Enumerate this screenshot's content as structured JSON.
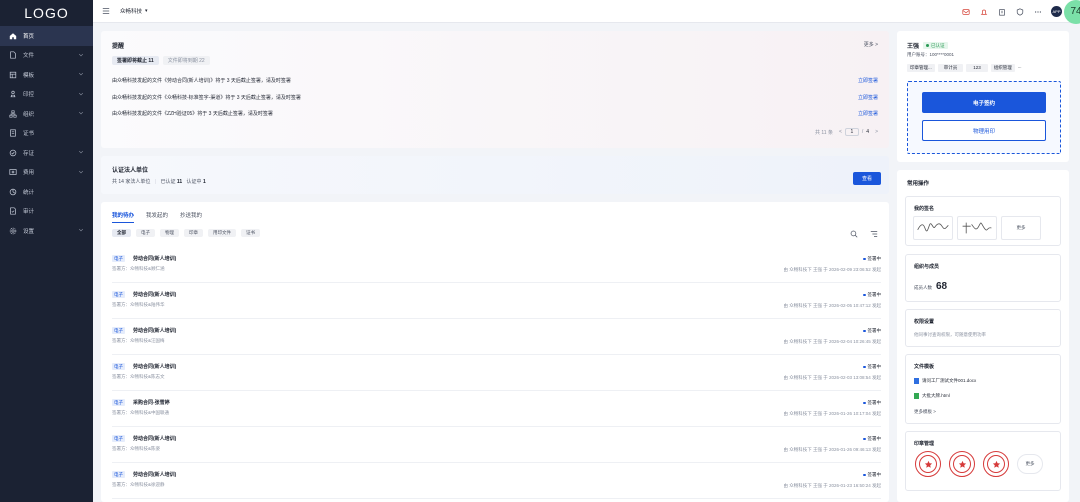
{
  "sidebar": {
    "logo": "LOGO",
    "items": [
      {
        "label": "首页",
        "icon": "home-icon",
        "active": true,
        "chevron": false
      },
      {
        "label": "文件",
        "icon": "file-icon",
        "active": false,
        "chevron": true
      },
      {
        "label": "模板",
        "icon": "template-icon",
        "active": false,
        "chevron": true
      },
      {
        "label": "印控",
        "icon": "seal-icon",
        "active": false,
        "chevron": true
      },
      {
        "label": "组织",
        "icon": "org-icon",
        "active": false,
        "chevron": true
      },
      {
        "label": "证书",
        "icon": "certificate-icon",
        "active": false,
        "chevron": false
      },
      {
        "label": "存证",
        "icon": "evidence-icon",
        "active": false,
        "chevron": true
      },
      {
        "label": "费用",
        "icon": "fee-icon",
        "active": false,
        "chevron": true
      },
      {
        "label": "统计",
        "icon": "stats-icon",
        "active": false,
        "chevron": false
      },
      {
        "label": "审计",
        "icon": "audit-icon",
        "active": false,
        "chevron": false
      },
      {
        "label": "设置",
        "icon": "settings-icon",
        "active": false,
        "chevron": true
      }
    ]
  },
  "topbar": {
    "org_name": "众畅科技",
    "avatar_text": "APP",
    "badge_count": "74"
  },
  "reminder": {
    "title": "提醒",
    "more": "更多 >",
    "chip_active": "签署即将截止 11",
    "chip_inactive": "文件即将到期 22",
    "rows": [
      {
        "text": "由众畅科技发起的文件《劳动合同(新人培训)》将于 3 天后截止签署，请及时签署",
        "action": "立即签署"
      },
      {
        "text": "由众畅科技发起的文件《众畅科技-标准签字-渠道》将于 3 天后截止签署，请及时签署",
        "action": "立即签署"
      },
      {
        "text": "由众畅科技发起的文件《ZZH验证05》将于 3 天后截止签署，请及时签署",
        "action": "立即签署"
      }
    ],
    "pager": {
      "total": "共 11 条",
      "prev": "<",
      "current": "1",
      "separator": "/",
      "pages": "4",
      "next": ">"
    }
  },
  "cert": {
    "title": "认证法人单位",
    "summary": "共 14 家法人单位",
    "certified_label": "已认证",
    "certified_value": "11",
    "pending_label": "认证中",
    "pending_value": "1",
    "button": "查看"
  },
  "todo": {
    "tabs": [
      "我的待办",
      "我发起的",
      "抄送我的"
    ],
    "filters": [
      "全部",
      "电子",
      "物理",
      "印章",
      "用印文件",
      "证书"
    ],
    "items": [
      {
        "tag": "电子",
        "title": "劳动合同(新人培训)",
        "party": "签署方：众畅科技&顾仁涵",
        "status": "签署中",
        "meta": "由 众畅科技下 王强 于 2026-02-09 23:06:52 发起"
      },
      {
        "tag": "电子",
        "title": "劳动合同(新人培训)",
        "party": "签署方：众畅科技&陆伟华",
        "status": "签署中",
        "meta": "由 众畅科技下 王强 于 2026-02-05 10:47:12 发起"
      },
      {
        "tag": "电子",
        "title": "劳动合同(新人培训)",
        "party": "签署方：众畅科技&汪国梅",
        "status": "签署中",
        "meta": "由 众畅科技下 王强 于 2026-02-04 10:26:45 发起"
      },
      {
        "tag": "电子",
        "title": "劳动合同(新人培训)",
        "party": "签署方：众畅科技&陈志文",
        "status": "签署中",
        "meta": "由 众畅科技下 王强 于 2026-02-03 13:08:54 发起"
      },
      {
        "tag": "电子",
        "title": "采购合同-张雪婷",
        "party": "签署方：众畅科技&中国联通",
        "status": "签署中",
        "meta": "由 众畅科技下 王强 于 2026-01-26 10:17:04 发起"
      },
      {
        "tag": "电子",
        "title": "劳动合同(新人培训)",
        "party": "签署方：众畅科技&陈姿",
        "status": "签署中",
        "meta": "由 众畅科技下 王强 于 2026-01-26 09:46:13 发起"
      },
      {
        "tag": "电子",
        "title": "劳动合同(新人培训)",
        "party": "签署方：众畅科技&徐迎静",
        "status": "签署中",
        "meta": "由 众畅科技下 王强 于 2026-01-23 16:50:24 发起"
      }
    ]
  },
  "user": {
    "name": "王强",
    "verified": "已认证",
    "account_label": "用户账号：",
    "account": "100****0001",
    "tags": [
      "印章管理...",
      "审计员",
      "123",
      "组织管理"
    ],
    "tag_more": "...",
    "btn_esign": "电子签约",
    "btn_physical": "物理用印"
  },
  "ops": {
    "title": "常用操作",
    "signature": {
      "title": "我的签名",
      "more": "更多"
    },
    "org": {
      "title": "组织与成员",
      "label": "成员人数",
      "count": "68"
    },
    "permission": {
      "title": "权限设置",
      "desc": "他同事讨查询权限，可随意使用功率"
    },
    "files": {
      "title": "文件模板",
      "items": [
        "请问工厂测试文件001.docx",
        "大批大牌.html"
      ],
      "more": "更多模板 >"
    },
    "seals": {
      "title": "印章管理",
      "more": "更多"
    }
  }
}
